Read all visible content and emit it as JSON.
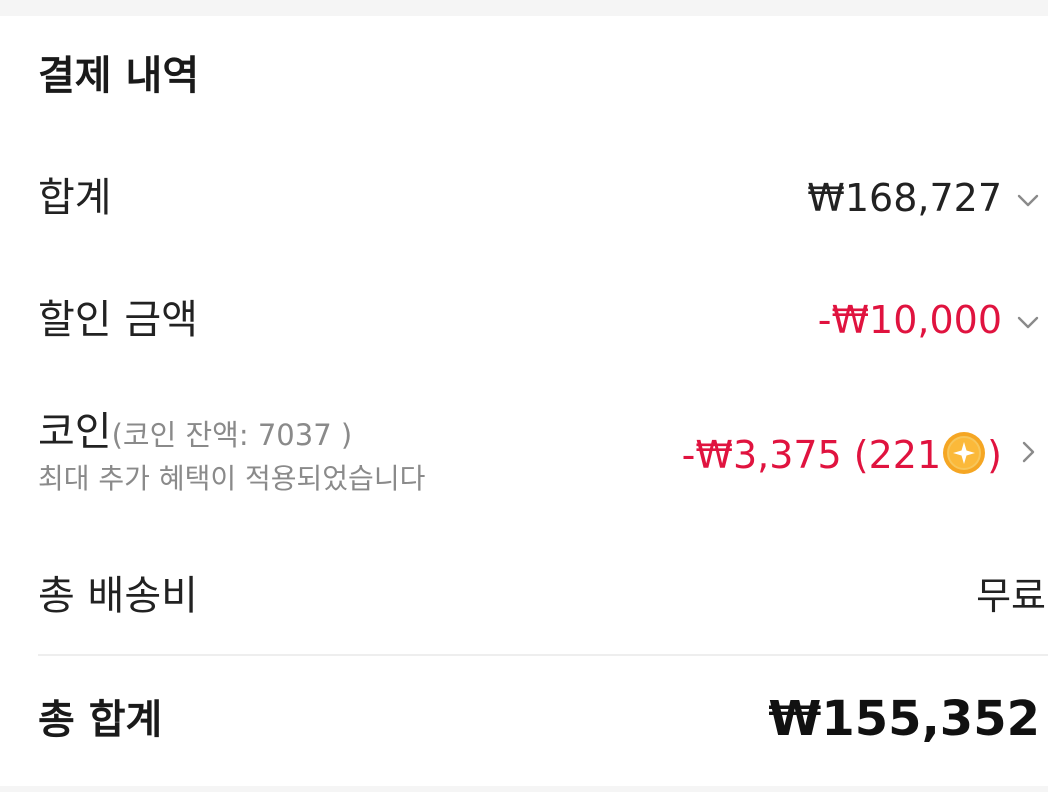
{
  "section_title": "결제 내역",
  "subtotal": {
    "label": "합계",
    "value": "₩168,727"
  },
  "discount": {
    "label": "할인 금액",
    "value": "-₩10,000"
  },
  "coin": {
    "label": "코인",
    "balance_text": "(코인 잔액: 7037 )",
    "note": "최대 추가 혜택이 적용되었습니다",
    "value": "-₩3,375 (221",
    "value_close": ")"
  },
  "shipping": {
    "label": "총 배송비",
    "value": "무료"
  },
  "total": {
    "label": "총 합계",
    "value": "₩155,352"
  },
  "colors": {
    "accent_red": "#e0133f",
    "text_gray": "#8a8a8a",
    "coin_gold": "#f5a623"
  },
  "icons": {
    "expand": "chevron-down-icon",
    "navigate": "chevron-right-icon",
    "coin": "coin-icon"
  }
}
